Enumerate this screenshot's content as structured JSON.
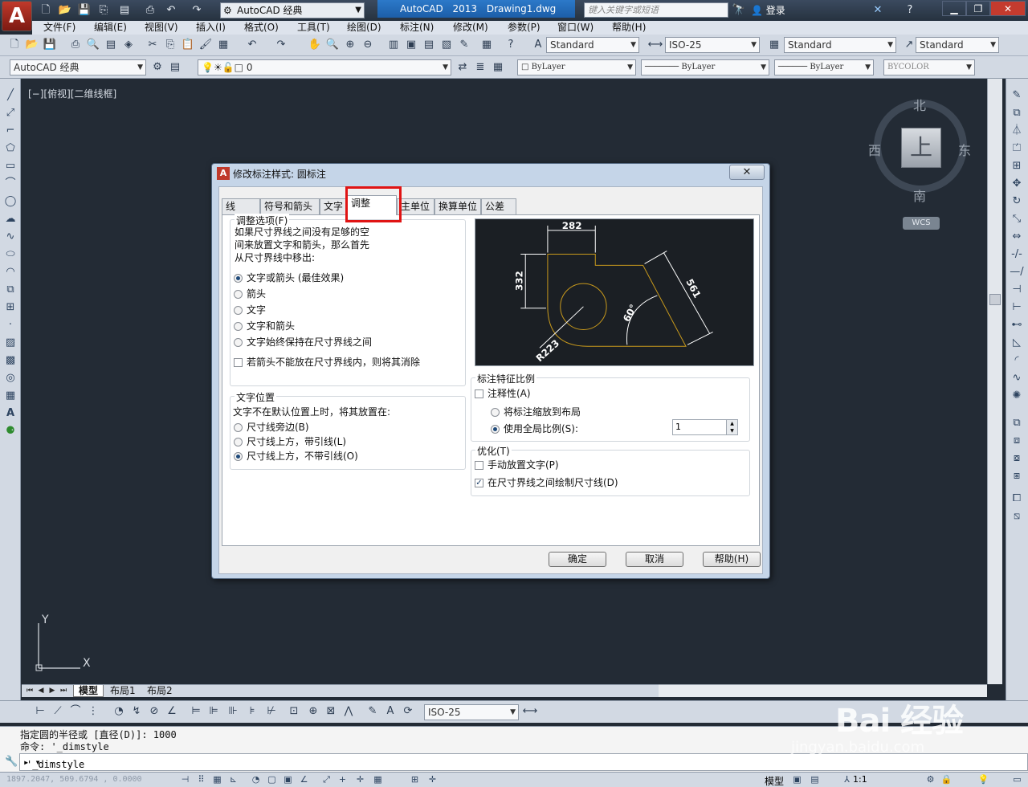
{
  "app": {
    "logo_letter": "A",
    "workspace": "AutoCAD 经典",
    "title": "AutoCAD 2013    Drawing1.dwg",
    "search_placeholder": "键入关键字或短语",
    "login": "登录"
  },
  "menu": [
    "文件(F)",
    "编辑(E)",
    "视图(V)",
    "插入(I)",
    "格式(O)",
    "工具(T)",
    "绘图(D)",
    "标注(N)",
    "修改(M)",
    "参数(P)",
    "窗口(W)",
    "帮助(H)"
  ],
  "toolbar": {
    "text_style": "Standard",
    "dim_style": "ISO-25",
    "table_style": "Standard",
    "mleader_style": "Standard",
    "workspace_combo": "AutoCAD 经典",
    "layer": "0",
    "color": "ByLayer",
    "linetype": "ByLayer",
    "lineweight": "ByLayer",
    "plotstyle": "BYCOLOR"
  },
  "viewport_label": "[−][俯视][二维线框]",
  "viewcube": {
    "north": "北",
    "south": "南",
    "west": "西",
    "east": "东",
    "face": "上",
    "wcs": "WCS"
  },
  "ucs": {
    "x": "X",
    "y": "Y"
  },
  "layout_tabs": [
    "模型",
    "布局1",
    "布局2"
  ],
  "dim_toolbar": {
    "style": "ISO-25"
  },
  "command": {
    "history1": "指定圆的半径或 [直径(D)]: 1000",
    "history2": "命令: '_dimstyle",
    "current": "'_dimstyle"
  },
  "status": {
    "coords": "1897.2047, 509.6794 , 0.0000",
    "model": "模型",
    "scale": "1:1"
  },
  "dialog": {
    "title": "修改标注样式: 圆标注",
    "close": "✕",
    "tabs": [
      "线",
      "符号和箭头",
      "文字",
      "调整",
      "主单位",
      "换算单位",
      "公差"
    ],
    "active_tab": "调整",
    "fit_group": {
      "title": "调整选项(F)",
      "desc1": "如果尺寸界线之间没有足够的空",
      "desc2": "间来放置文字和箭头，那么首先",
      "desc3": "从尺寸界线中移出:",
      "options": [
        "文字或箭头 (最佳效果)",
        "箭头",
        "文字",
        "文字和箭头",
        "文字始终保持在尺寸界线之间"
      ],
      "selected": 0,
      "suppress": "若箭头不能放在尺寸界线内，则将其消除"
    },
    "text_group": {
      "title": "文字位置",
      "desc": "文字不在默认位置上时，将其放置在:",
      "options": [
        "尺寸线旁边(B)",
        "尺寸线上方，带引线(L)",
        "尺寸线上方，不带引线(O)"
      ],
      "selected": 2
    },
    "scale_group": {
      "title": "标注特征比例",
      "annotative": "注释性(A)",
      "scale_layout": "将标注缩放到布局",
      "use_overall": "使用全局比例(S):",
      "overall_value": "1"
    },
    "fine_group": {
      "title": "优化(T)",
      "manual": "手动放置文字(P)",
      "draw_dimline": "在尺寸界线之间绘制尺寸线(D)"
    },
    "preview_labels": {
      "d1": "282",
      "d2": "332",
      "d3": "561",
      "angle": "60°",
      "radius": "R223"
    },
    "buttons": {
      "ok": "确定",
      "cancel": "取消",
      "help": "帮助(H)"
    }
  },
  "watermark": {
    "brand": "Bai 经验",
    "url": "jingyan.baidu.com"
  }
}
